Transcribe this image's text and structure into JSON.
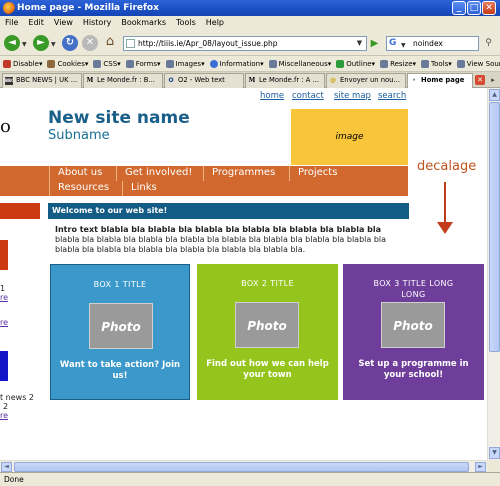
{
  "window": {
    "title": "Home page - Mozilla Firefox",
    "min": "_",
    "max": "□",
    "close": "✕"
  },
  "menu": [
    "File",
    "Edit",
    "View",
    "History",
    "Bookmarks",
    "Tools",
    "Help"
  ],
  "nav": {
    "url": "http://tiiis.ie/Apr_08/layout_issue.php",
    "search_value": "noindex",
    "search_engine_letter": "G"
  },
  "devbar": {
    "items": [
      {
        "label": "Disable▾",
        "color": "#c0392b"
      },
      {
        "label": "Cookies▾",
        "color": "#8e6b3e"
      },
      {
        "label": "CSS▾",
        "color": "#6a7a99"
      },
      {
        "label": "Forms▾",
        "color": "#6a7a99"
      },
      {
        "label": "Images▾",
        "color": "#6a7a99"
      },
      {
        "label": "Information▾",
        "color": "#3b6fd8"
      },
      {
        "label": "Miscellaneous▾",
        "color": "#6a7a99"
      },
      {
        "label": "Outline▾",
        "color": "#2e9a3a"
      },
      {
        "label": "Resize▾",
        "color": "#6a7a99"
      },
      {
        "label": "Tools▾",
        "color": "#6a7a99"
      },
      {
        "label": "View Source▾",
        "color": "#6a7a99"
      }
    ]
  },
  "tabs": [
    {
      "label": "BBC NEWS | UK ...",
      "icon": "BBC"
    },
    {
      "label": "Le Monde.fr : B...",
      "icon": "M"
    },
    {
      "label": "O2 - Web text",
      "icon": "O"
    },
    {
      "label": "Le Monde.fr : A ...",
      "icon": "M"
    },
    {
      "label": "Envoyer un nou...",
      "icon": "@"
    },
    {
      "label": "Home page",
      "icon": "•",
      "active": true
    }
  ],
  "page": {
    "top_links": [
      "home",
      "contact",
      "site map",
      "search"
    ],
    "left_cut_char": "o",
    "site_name": "New site name",
    "site_sub": "Subname",
    "image_label": "image",
    "menu": [
      "About us",
      "Get involved!",
      "Programmes",
      "Projects",
      "Resources",
      "Links"
    ],
    "welcome": "Welcome to our web site!",
    "intro_bold": "Intro text blabla bla blabla bla blabla bla blabla bla blabla bla blabla bla",
    "intro_rest": " blabla bla blabla bla blabla bla blabla bla blabla bla blabla bla blabla bla blabla bla blabla bla blabla bla blabla bla blabla bla blabla bla blabla bla.",
    "left_snippets": [
      "1",
      "re",
      "re",
      "t news 2",
      "2",
      "re"
    ],
    "boxes": [
      {
        "title": "BOX 1 TITLE",
        "photo": "Photo",
        "text": "Want to take action? Join us!",
        "color": "#3b98ca"
      },
      {
        "title": "BOX 2 TITLE",
        "photo": "Photo",
        "text": "Find out how we can help your town",
        "color": "#95c51d"
      },
      {
        "title": "BOX 3 TITLE LONG LONG",
        "photo": "Photo",
        "text": "Set up a programme in your school!",
        "color": "#6e3e9a"
      }
    ],
    "annotation": "decalage"
  },
  "status": "Done"
}
